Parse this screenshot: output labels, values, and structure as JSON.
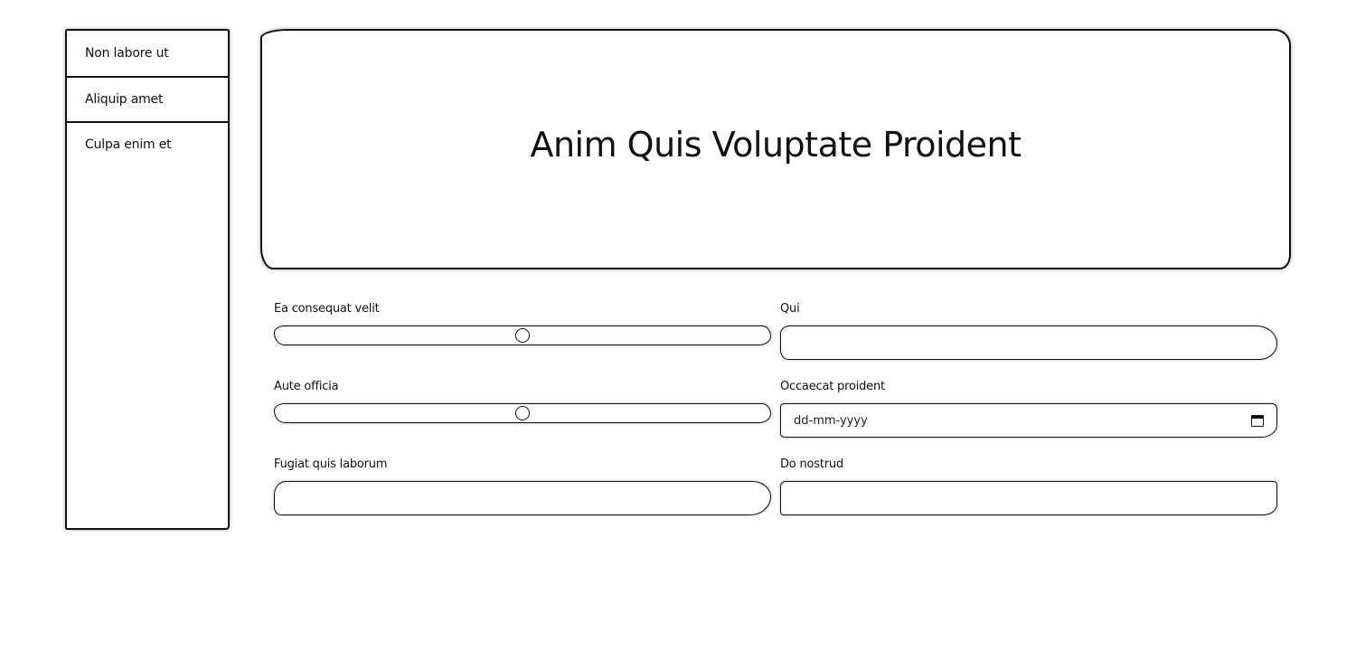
{
  "sidebar": {
    "items": [
      {
        "label": "Non labore ut"
      },
      {
        "label": "Aliquip amet"
      },
      {
        "label": "Culpa enim et"
      }
    ]
  },
  "hero": {
    "title": "Anim Quis Voluptate Proident"
  },
  "form": {
    "ea_consequat_velit": {
      "label": "Ea consequat velit",
      "value_fraction": 0.5
    },
    "qui": {
      "label": "Qui",
      "value": ""
    },
    "aute_officia": {
      "label": "Aute officia",
      "value_fraction": 0.5
    },
    "occaecat_proident": {
      "label": "Occaecat proident",
      "placeholder": "dd-mm-yyyy"
    },
    "fugiat_quis_laborum": {
      "label": "Fugiat quis laborum",
      "value": ""
    },
    "do_nostrud": {
      "label": "Do nostrud",
      "value": ""
    }
  },
  "icons": {
    "date_picker": "calendar-icon"
  }
}
